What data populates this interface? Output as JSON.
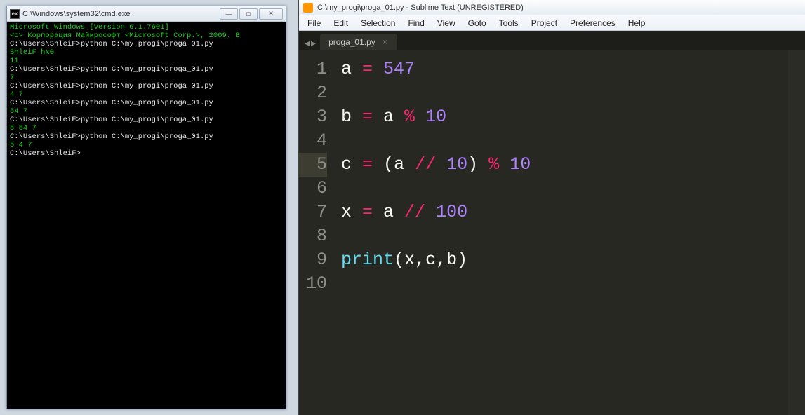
{
  "cmd": {
    "title": "C:\\Windows\\system32\\cmd.exe",
    "icon_label": "ex",
    "buttons": {
      "min": "—",
      "max": "□",
      "close": "✕"
    },
    "lines": [
      {
        "cls": "out",
        "text": "Microsoft Windows [Version 6.1.7601]"
      },
      {
        "cls": "out",
        "text": "<c> Корпорация Майкрософт <Microsoft Corp.>, 2009. В"
      },
      {
        "cls": "out",
        "text": ""
      },
      {
        "cls": "white",
        "text": "C:\\Users\\ShleiF>python C:\\my_progi\\proga_01.py"
      },
      {
        "cls": "out",
        "text": "ShleiF hx0"
      },
      {
        "cls": "out",
        "text": "11"
      },
      {
        "cls": "out",
        "text": ""
      },
      {
        "cls": "white",
        "text": "C:\\Users\\ShleiF>python C:\\my_progi\\proga_01.py"
      },
      {
        "cls": "out",
        "text": "7"
      },
      {
        "cls": "out",
        "text": ""
      },
      {
        "cls": "white",
        "text": "C:\\Users\\ShleiF>python C:\\my_progi\\proga_01.py"
      },
      {
        "cls": "out",
        "text": "4 7"
      },
      {
        "cls": "out",
        "text": ""
      },
      {
        "cls": "white",
        "text": "C:\\Users\\ShleiF>python C:\\my_progi\\proga_01.py"
      },
      {
        "cls": "out",
        "text": "54 7"
      },
      {
        "cls": "out",
        "text": ""
      },
      {
        "cls": "white",
        "text": "C:\\Users\\ShleiF>python C:\\my_progi\\proga_01.py"
      },
      {
        "cls": "out",
        "text": "5 54 7"
      },
      {
        "cls": "out",
        "text": ""
      },
      {
        "cls": "white",
        "text": "C:\\Users\\ShleiF>python C:\\my_progi\\proga_01.py"
      },
      {
        "cls": "out",
        "text": "5 4 7"
      },
      {
        "cls": "out",
        "text": ""
      },
      {
        "cls": "white",
        "text": "C:\\Users\\ShleiF>"
      }
    ]
  },
  "sublime": {
    "title": "C:\\my_progi\\proga_01.py - Sublime Text (UNREGISTERED)",
    "menu": [
      "File",
      "Edit",
      "Selection",
      "Find",
      "View",
      "Goto",
      "Tools",
      "Project",
      "Preferences",
      "Help"
    ],
    "menu_underline": [
      "F",
      "E",
      "S",
      "i",
      "V",
      "G",
      "T",
      "P",
      "n",
      "H"
    ],
    "tab": {
      "label": "proga_01.py",
      "close": "×"
    },
    "tabnav": {
      "left": "◂",
      "right": "▸"
    },
    "current_line": 5,
    "lines": [
      {
        "n": 1,
        "tokens": [
          [
            "var",
            "a "
          ],
          [
            "op",
            "="
          ],
          [
            "var",
            " "
          ],
          [
            "num",
            "547"
          ]
        ]
      },
      {
        "n": 2,
        "tokens": []
      },
      {
        "n": 3,
        "tokens": [
          [
            "var",
            "b "
          ],
          [
            "op",
            "="
          ],
          [
            "var",
            " a "
          ],
          [
            "op",
            "%"
          ],
          [
            "var",
            " "
          ],
          [
            "num",
            "10"
          ]
        ]
      },
      {
        "n": 4,
        "tokens": []
      },
      {
        "n": 5,
        "tokens": [
          [
            "var",
            "c "
          ],
          [
            "op",
            "="
          ],
          [
            "var",
            " "
          ],
          [
            "par",
            "("
          ],
          [
            "var",
            "a "
          ],
          [
            "op",
            "//"
          ],
          [
            "var",
            " "
          ],
          [
            "num",
            "10"
          ],
          [
            "par",
            ")"
          ],
          [
            "var",
            " "
          ],
          [
            "op",
            "%"
          ],
          [
            "var",
            " "
          ],
          [
            "num",
            "10"
          ]
        ]
      },
      {
        "n": 6,
        "tokens": []
      },
      {
        "n": 7,
        "tokens": [
          [
            "var",
            "x "
          ],
          [
            "op",
            "="
          ],
          [
            "var",
            " a "
          ],
          [
            "op",
            "//"
          ],
          [
            "var",
            " "
          ],
          [
            "num",
            "100"
          ]
        ]
      },
      {
        "n": 8,
        "tokens": []
      },
      {
        "n": 9,
        "tokens": [
          [
            "func",
            "print"
          ],
          [
            "par",
            "("
          ],
          [
            "var",
            "x"
          ],
          [
            "par",
            ","
          ],
          [
            "var",
            "c"
          ],
          [
            "par",
            ","
          ],
          [
            "var",
            "b"
          ],
          [
            "par",
            ")"
          ]
        ]
      },
      {
        "n": 10,
        "tokens": []
      }
    ]
  }
}
